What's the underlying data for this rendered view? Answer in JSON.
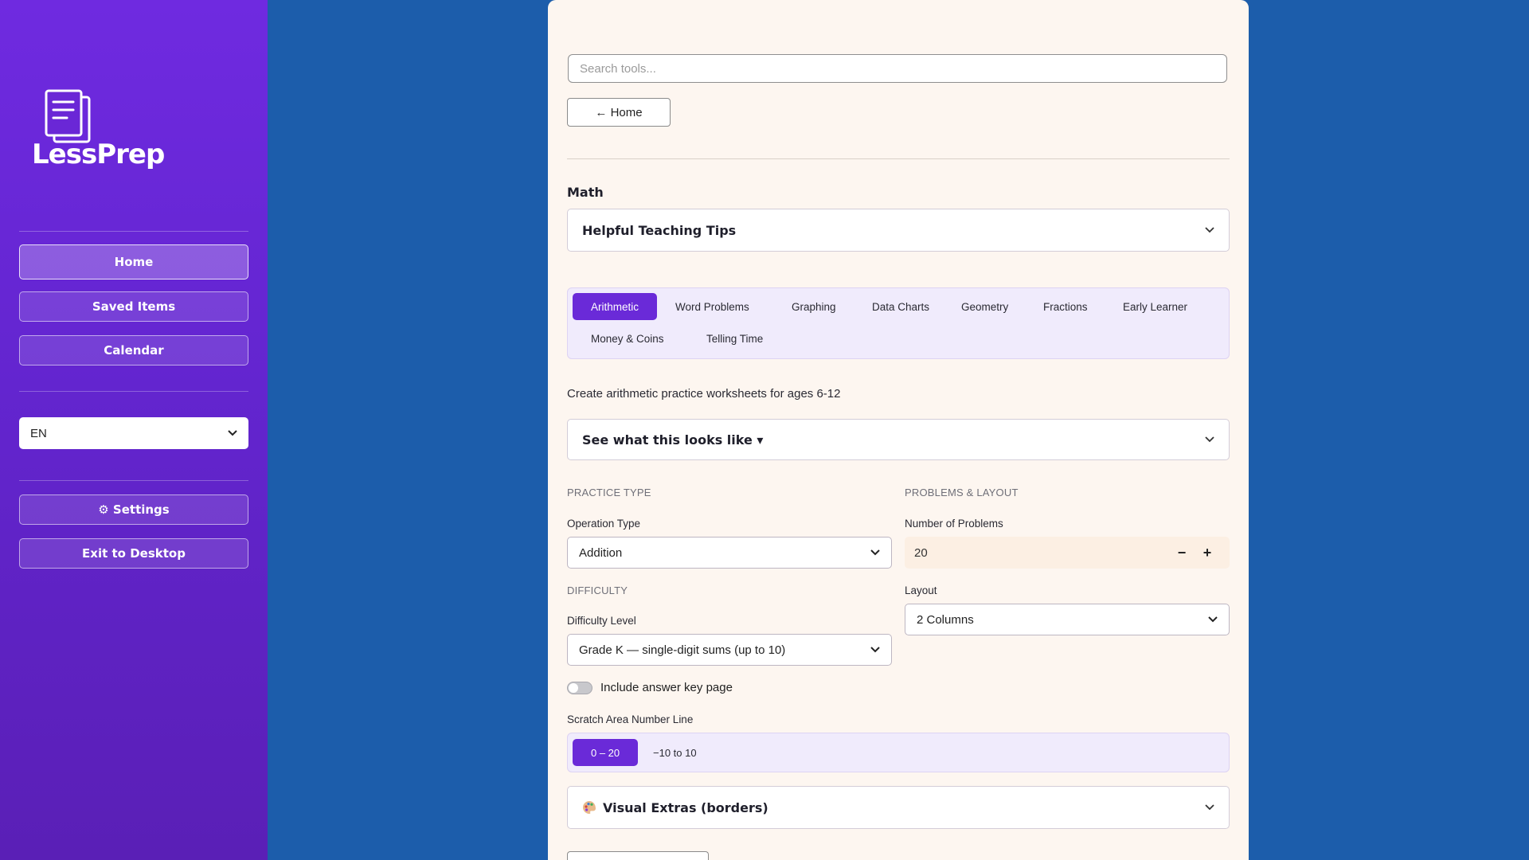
{
  "sidebar": {
    "logo_text": "LessPrep",
    "nav": [
      {
        "label": "Home"
      },
      {
        "label": "Saved Items"
      },
      {
        "label": "Calendar"
      }
    ],
    "language": "EN",
    "settings_label": "⚙ Settings",
    "exit_label": "Exit to Desktop"
  },
  "main": {
    "search_placeholder": "Search tools...",
    "home_label": "← Home",
    "section_title": "Math",
    "tips_label": "Helpful Teaching Tips",
    "tabs": [
      {
        "label": "Arithmetic",
        "active": true
      },
      {
        "label": "Word Problems"
      },
      {
        "label": "Graphing"
      },
      {
        "label": "Data Charts"
      },
      {
        "label": "Geometry"
      },
      {
        "label": "Fractions"
      },
      {
        "label": "Early Learner"
      },
      {
        "label": "Money & Coins"
      },
      {
        "label": "Telling Time"
      }
    ],
    "description": "Create arithmetic practice worksheets for ages 6-12",
    "preview_label": "See what this looks like ▾",
    "practice_type_heading": "PRACTICE TYPE",
    "operation_label": "Operation Type",
    "operation_value": "Addition",
    "difficulty_heading": "DIFFICULTY",
    "difficulty_label": "Difficulty Level",
    "difficulty_value": "Grade K — single-digit sums (up to 10)",
    "problems_heading": "PROBLEMS & LAYOUT",
    "num_problems_label": "Number of Problems",
    "num_problems_value": "20",
    "layout_label": "Layout",
    "layout_value": "2 Columns",
    "answer_key_label": "Include answer key page",
    "answer_key_on": false,
    "number_line_label": "Scratch Area Number Line",
    "number_line_options": [
      {
        "label": "0 – 20",
        "active": true
      },
      {
        "label": "−10 to 10"
      }
    ],
    "visual_extras_label": "Visual Extras (borders)"
  },
  "colors": {
    "accent": "#6a2ad8",
    "background": "#1c5dab",
    "panel": "#fdf6f0"
  }
}
